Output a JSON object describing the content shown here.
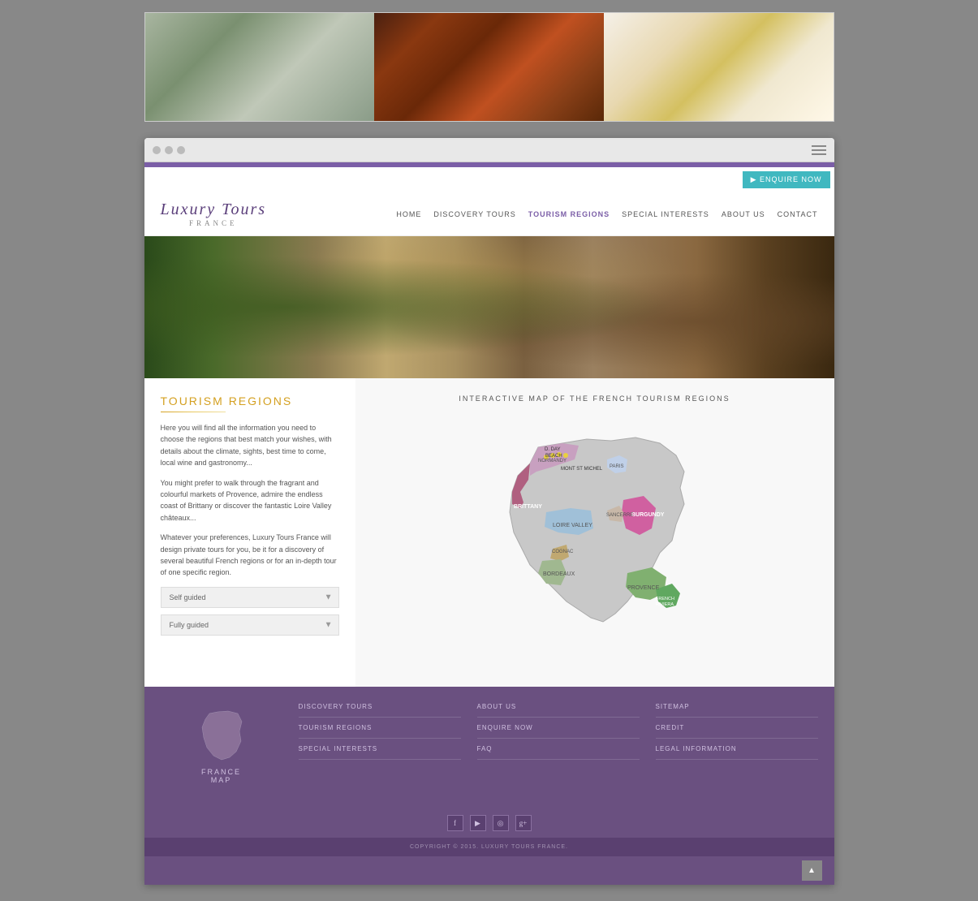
{
  "topImages": [
    {
      "id": "stone",
      "alt": "Stone monument"
    },
    {
      "id": "sausage",
      "alt": "French sausages"
    },
    {
      "id": "dessert",
      "alt": "French dessert"
    }
  ],
  "browser": {
    "dots": [
      "red",
      "yellow",
      "green"
    ]
  },
  "nav": {
    "enquire_btn": "ENQUIRE NOW",
    "logo_main": "Luxury Tours",
    "logo_sub": "FRANCE",
    "links": [
      {
        "label": "HOME",
        "href": "#",
        "active": false
      },
      {
        "label": "DISCOVERY TOURS",
        "href": "#",
        "active": false
      },
      {
        "label": "TOURISM REGIONS",
        "href": "#",
        "active": true
      },
      {
        "label": "SPECIAL INTERESTS",
        "href": "#",
        "active": false
      },
      {
        "label": "ABOUT US",
        "href": "#",
        "active": false
      },
      {
        "label": "CONTACT",
        "href": "#",
        "active": false
      }
    ]
  },
  "main": {
    "section_title": "TOURISM REGIONS",
    "text1": "Here you will find all the information you need to choose the regions that best match your wishes, with details about the climate, sights, best time to come, local wine and gastronomy...",
    "text2": "You might prefer to walk through the fragrant and colourful markets of Provence, admire the endless coast of Brittany or discover the fantastic Loire Valley châteaux...",
    "text3": "Whatever your preferences, Luxury Tours France will design private tours for you, be it for a discovery of several beautiful French regions or for an in-depth tour of one specific region.",
    "dropdown1": "Self guided",
    "dropdown2": "Fully guided",
    "map_title": "INTERACTIVE MAP OF THE FRENCH TOURISM REGIONS",
    "regions": [
      {
        "name": "BRITTANY",
        "color": "#b06080"
      },
      {
        "name": "NORMANDY",
        "color": "#c8a0c0"
      },
      {
        "name": "D. DAY BEACH",
        "color": "#e8d040"
      },
      {
        "name": "MONT ST MICHEL",
        "color": "#e8e060"
      },
      {
        "name": "PARIS",
        "color": "#c0d0e8"
      },
      {
        "name": "LOIRE VALLEY",
        "color": "#a0c0d8"
      },
      {
        "name": "BURGUNDY",
        "color": "#d060a0"
      },
      {
        "name": "SANCERRE",
        "color": "#c8c0a0"
      },
      {
        "name": "COGNAC",
        "color": "#c0a870"
      },
      {
        "name": "BORDEAUX",
        "color": "#a0b890"
      },
      {
        "name": "PROVENCE",
        "color": "#80b070"
      },
      {
        "name": "FRENCH RIVIERA",
        "color": "#60a860"
      }
    ]
  },
  "footer": {
    "france_map_label": "FRANCE\nMAP",
    "copyright": "COPYRIGHT © 2015. LUXURY TOURS FRANCE.",
    "col1": [
      {
        "label": "DISCOVERY TOURS"
      },
      {
        "label": "TOURISM REGIONS"
      },
      {
        "label": "SPECIAL INTERESTS"
      }
    ],
    "col2": [
      {
        "label": "ABOUT US"
      },
      {
        "label": "ENQUIRE  NOW"
      },
      {
        "label": "FAQ"
      }
    ],
    "col3": [
      {
        "label": "SITEMAP"
      },
      {
        "label": "CREDIT"
      },
      {
        "label": "LEGAL INFORMATION"
      }
    ],
    "social": [
      "f",
      "▶",
      "◎",
      "g+"
    ]
  }
}
